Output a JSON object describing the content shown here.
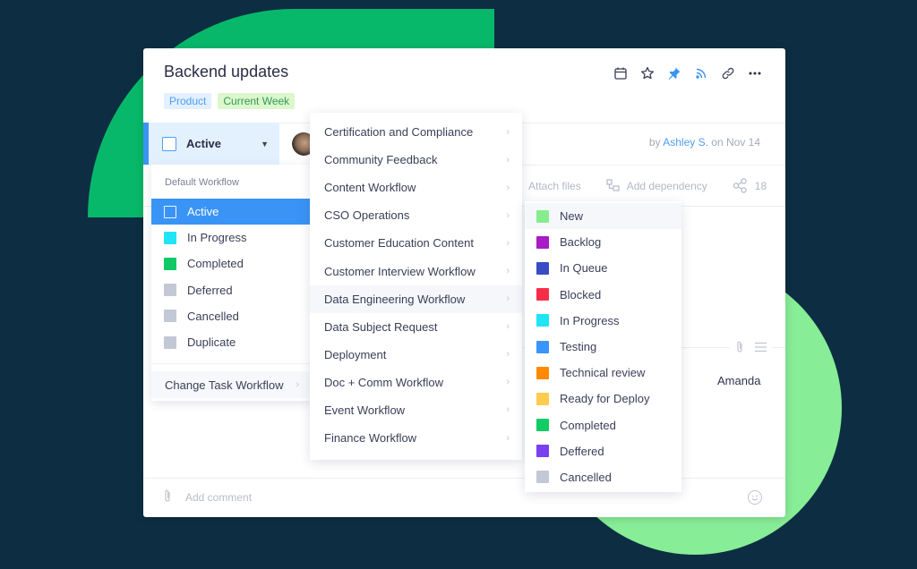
{
  "task": {
    "title": "Backend updates",
    "tags": [
      {
        "label": "Product",
        "color": "#4c9ff0",
        "bg": "#e2f0ff"
      },
      {
        "label": "Current Week",
        "color": "#31995a",
        "bg": "#dcf7cc"
      }
    ],
    "header_actions": [
      {
        "name": "calendar-icon",
        "color": "#3a3e57"
      },
      {
        "name": "star-icon",
        "color": "#3a3e57"
      },
      {
        "name": "pin-icon",
        "color": "#3a94f5"
      },
      {
        "name": "rss-icon",
        "color": "#3a94f5"
      },
      {
        "name": "link-icon",
        "color": "#3a3e57"
      },
      {
        "name": "more-icon",
        "color": "#3a3e57"
      }
    ],
    "status": {
      "label": "Active",
      "accent": "#3a94f5"
    },
    "byline": {
      "prefix": "by",
      "author": "Ashley S.",
      "suffix": "on Nov 14"
    },
    "toolbar": {
      "attach_files": "Attach files",
      "add_dependency": "Add dependency",
      "share_count": "18"
    },
    "assignee": "Amanda",
    "comment_placeholder": "Add comment"
  },
  "status_menu": {
    "heading": "Default Workflow",
    "items": [
      {
        "label": "Active",
        "color": "#ffffff",
        "selected": true
      },
      {
        "label": "In Progress",
        "color": "#1fe5f5"
      },
      {
        "label": "Completed",
        "color": "#0fc965"
      },
      {
        "label": "Deferred",
        "color": "#c3c8d6"
      },
      {
        "label": "Cancelled",
        "color": "#c3c8d6"
      },
      {
        "label": "Duplicate",
        "color": "#c3c8d6"
      }
    ],
    "change_workflow": "Change Task Workflow"
  },
  "workflow_menu": {
    "items": [
      "Certification and Compliance",
      "Community Feedback",
      "Content Workflow",
      "CSO Operations",
      "Customer Education Content",
      "Customer Interview Workflow",
      "Data Engineering Workflow",
      "Data Subject Request",
      "Deployment",
      "Doc + Comm Workflow",
      "Event Workflow",
      "Finance Workflow"
    ],
    "hovered": "Data Engineering Workflow"
  },
  "workflow_status_menu": {
    "items": [
      {
        "label": "New",
        "color": "#86ed8f"
      },
      {
        "label": "Backlog",
        "color": "#a71cc4"
      },
      {
        "label": "In Queue",
        "color": "#3a4cc4"
      },
      {
        "label": "Blocked",
        "color": "#f72d48"
      },
      {
        "label": "In Progress",
        "color": "#1fe5f5"
      },
      {
        "label": "Testing",
        "color": "#3895f9"
      },
      {
        "label": "Technical review",
        "color": "#ff8a00"
      },
      {
        "label": "Ready for Deploy",
        "color": "#ffcc4d"
      },
      {
        "label": "Completed",
        "color": "#12cc64"
      },
      {
        "label": "Deffered",
        "color": "#7a3ff0"
      },
      {
        "label": "Cancelled",
        "color": "#c3c8d6"
      }
    ]
  }
}
